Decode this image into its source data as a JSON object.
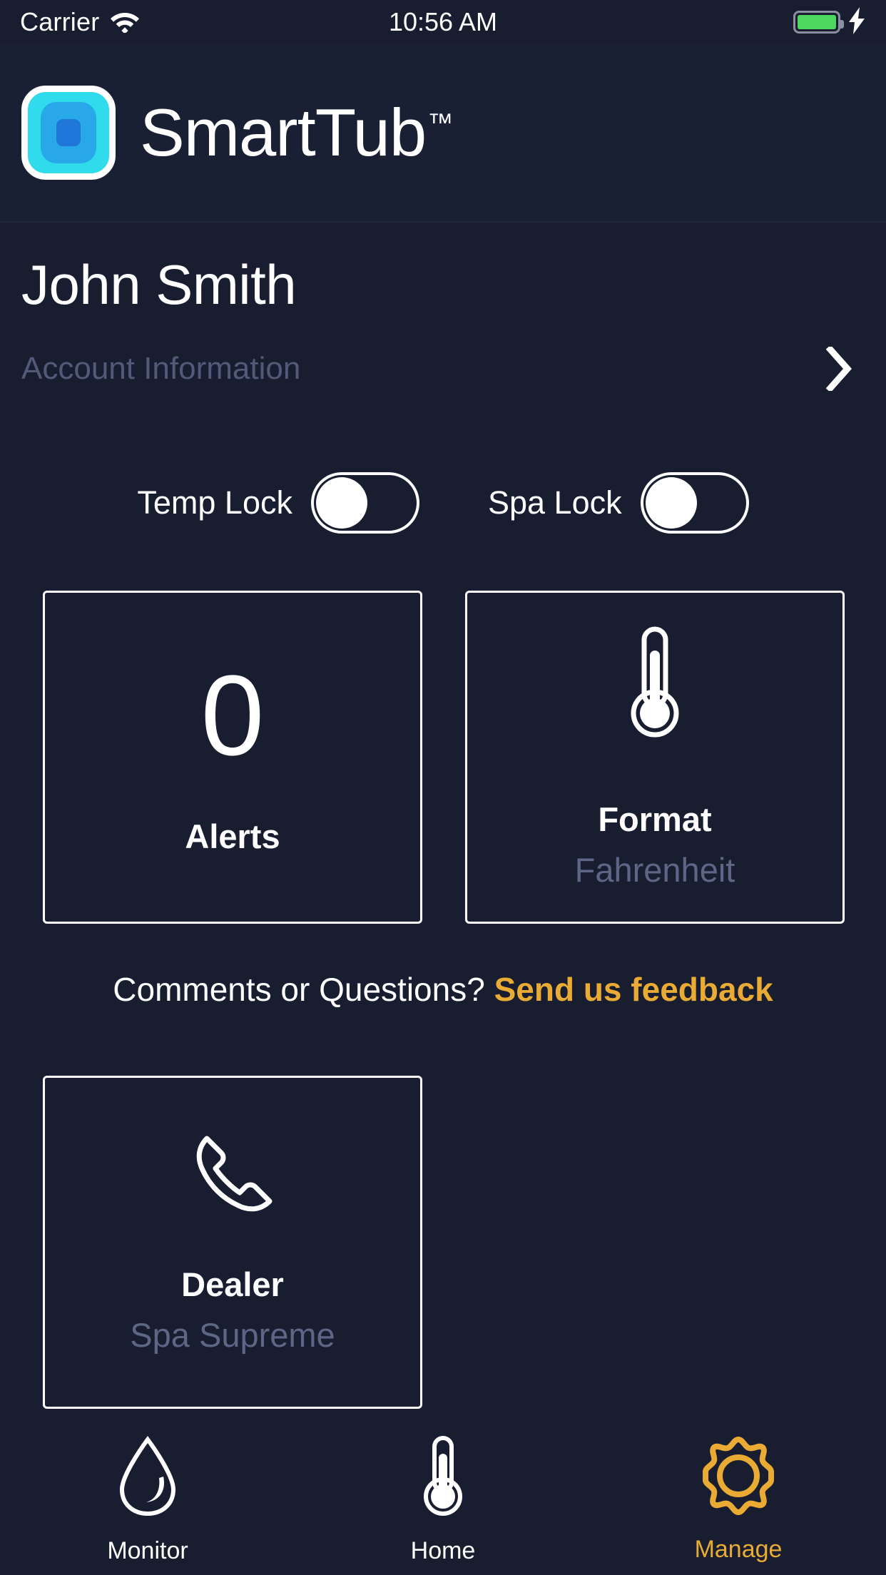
{
  "status_bar": {
    "carrier": "Carrier",
    "wifi_icon": "wifi-icon",
    "time": "10:56 AM",
    "battery_icon": "battery-full-icon",
    "charging_icon": "lightning-bolt-icon"
  },
  "header": {
    "logo_icon": "smarttub-logo-icon",
    "brand": "SmartTub",
    "trademark": "™"
  },
  "account": {
    "user_name": "John Smith",
    "info_label": "Account Information",
    "chevron_icon": "chevron-right-icon"
  },
  "locks": [
    {
      "label": "Temp Lock",
      "state": "off"
    },
    {
      "label": "Spa Lock",
      "state": "off"
    }
  ],
  "cards": {
    "alerts": {
      "count": "0",
      "title": "Alerts"
    },
    "format": {
      "icon": "thermometer-icon",
      "title": "Format",
      "value": "Fahrenheit"
    }
  },
  "feedback": {
    "prompt": "Comments or Questions? ",
    "link": "Send us feedback",
    "link_color": "#e9ab33"
  },
  "dealer": {
    "icon": "phone-icon",
    "title": "Dealer",
    "name": "Spa Supreme"
  },
  "bottom_nav": {
    "items": [
      {
        "label": "Monitor",
        "icon": "water-drop-icon",
        "active": false
      },
      {
        "label": "Home",
        "icon": "thermometer-icon",
        "active": false
      },
      {
        "label": "Manage",
        "icon": "gear-icon",
        "active": true
      }
    ],
    "active_color": "#e9ab33"
  },
  "colors": {
    "background": "#181d30",
    "header_background": "#1a2033",
    "muted_text": "#535a77",
    "accent": "#e9ab33",
    "logo_cyan": "#30dcec",
    "logo_mid_blue": "#28a8e8",
    "logo_inner_blue": "#1e77d8",
    "battery_green": "#4cd761"
  }
}
